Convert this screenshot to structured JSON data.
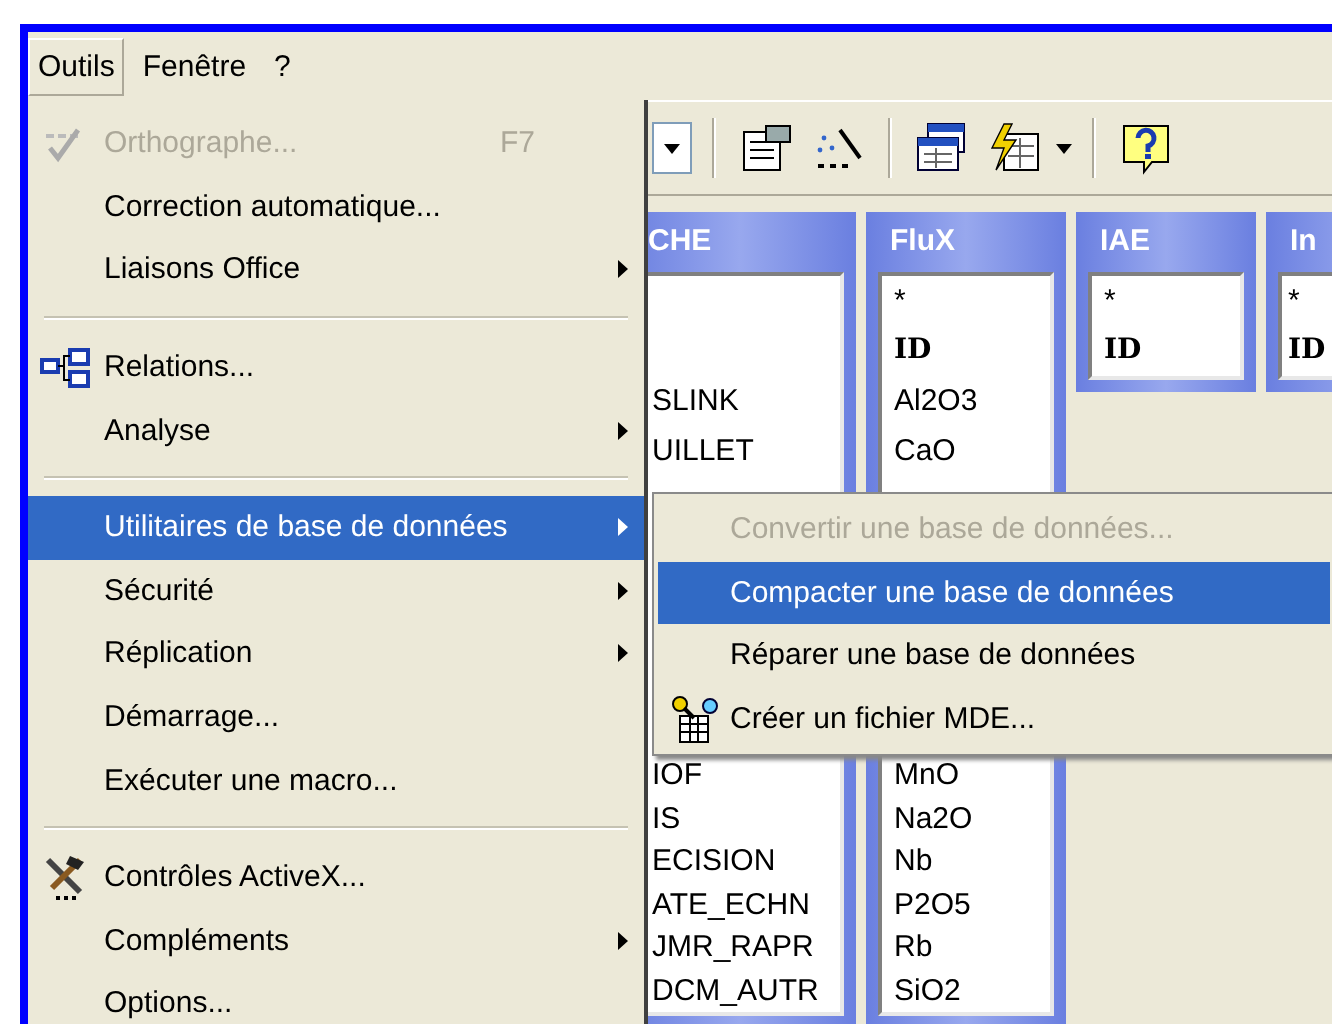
{
  "menubar": [
    {
      "label": "Outils",
      "selected": true
    },
    {
      "label": "Fenêtre",
      "selected": false
    },
    {
      "label": "?",
      "selected": false
    }
  ],
  "tables": [
    {
      "title": "CHE",
      "fields": [
        {
          "label": "SLINK",
          "key": false
        },
        {
          "label": "UILLET",
          "key": false
        }
      ],
      "fields_lower": [
        {
          "label": "IOF",
          "key": false
        },
        {
          "label": "IS",
          "key": false
        },
        {
          "label": "ECISION",
          "key": false
        },
        {
          "label": "ATE_ECHN",
          "key": false
        },
        {
          "label": "JMR_RAPR",
          "key": false
        },
        {
          "label": "DCM_AUTR",
          "key": false
        }
      ]
    },
    {
      "title": "FluX",
      "fields": [
        {
          "label": "*",
          "key": false
        },
        {
          "label": "ID",
          "key": true
        },
        {
          "label": "Al2O3",
          "key": false
        },
        {
          "label": "CaO",
          "key": false
        }
      ],
      "fields_lower": [
        {
          "label": "MnO",
          "key": false
        },
        {
          "label": "Na2O",
          "key": false
        },
        {
          "label": "Nb",
          "key": false
        },
        {
          "label": "P2O5",
          "key": false
        },
        {
          "label": "Rb",
          "key": false
        },
        {
          "label": "SiO2",
          "key": false
        }
      ]
    },
    {
      "title": "IAE",
      "fields": [
        {
          "label": "*",
          "key": false
        },
        {
          "label": "ID",
          "key": true
        }
      ]
    },
    {
      "title": "In",
      "fields": [
        {
          "label": "*",
          "key": false
        },
        {
          "label": "ID",
          "key": true
        }
      ]
    }
  ],
  "menu": {
    "items": [
      {
        "kind": "item",
        "label": "Orthographe...",
        "shortcut": "F7",
        "disabled": true,
        "submenu": false,
        "selected": false
      },
      {
        "kind": "item",
        "label": "Correction automatique...",
        "disabled": false,
        "submenu": false,
        "selected": false
      },
      {
        "kind": "item",
        "label": "Liaisons Office",
        "disabled": false,
        "submenu": true,
        "selected": false
      },
      {
        "kind": "separator"
      },
      {
        "kind": "item",
        "label": "Relations...",
        "disabled": false,
        "submenu": false,
        "selected": false
      },
      {
        "kind": "item",
        "label": "Analyse",
        "disabled": false,
        "submenu": true,
        "selected": false
      },
      {
        "kind": "separator"
      },
      {
        "kind": "item",
        "label": "Utilitaires de base de données",
        "disabled": false,
        "submenu": true,
        "selected": true
      },
      {
        "kind": "item",
        "label": "Sécurité",
        "disabled": false,
        "submenu": true,
        "selected": false
      },
      {
        "kind": "item",
        "label": "Réplication",
        "disabled": false,
        "submenu": true,
        "selected": false
      },
      {
        "kind": "item",
        "label": "Démarrage...",
        "disabled": false,
        "submenu": false,
        "selected": false
      },
      {
        "kind": "item",
        "label": "Exécuter une macro...",
        "disabled": false,
        "submenu": false,
        "selected": false
      },
      {
        "kind": "separator"
      },
      {
        "kind": "item",
        "label": "Contrôles ActiveX...",
        "disabled": false,
        "submenu": false,
        "selected": false
      },
      {
        "kind": "item",
        "label": "Compléments",
        "disabled": false,
        "submenu": true,
        "selected": false
      },
      {
        "kind": "item",
        "label": "Options...",
        "disabled": false,
        "submenu": false,
        "selected": false
      }
    ]
  },
  "submenu": {
    "items": [
      {
        "kind": "item",
        "label": "Convertir une base de données...",
        "disabled": true,
        "submenu": false,
        "selected": false
      },
      {
        "kind": "item",
        "label": "Compacter une base de données",
        "disabled": false,
        "submenu": false,
        "selected": true
      },
      {
        "kind": "item",
        "label": "Réparer une base de données",
        "disabled": false,
        "submenu": false,
        "selected": false
      },
      {
        "kind": "item",
        "label": "Créer un fichier MDE...",
        "disabled": false,
        "submenu": false,
        "selected": false
      }
    ]
  }
}
